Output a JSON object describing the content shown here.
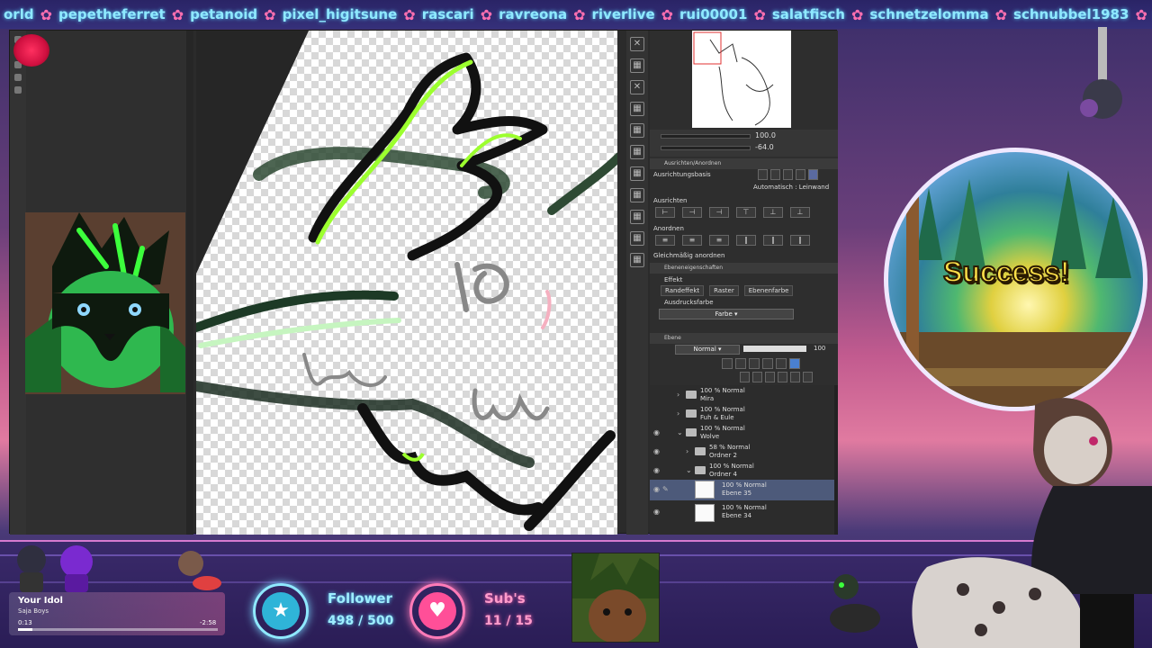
{
  "ticker": {
    "items": [
      "orld",
      "pepetheferret",
      "petanoid",
      "pixel_higitsune",
      "rascari",
      "ravreona",
      "riverlive",
      "rui00001",
      "salatfisch",
      "schnetzelomma",
      "schnubbel1983",
      "schw"
    ]
  },
  "app": {
    "navigator": {
      "zoom": "100.0",
      "rotation": "-64.0"
    },
    "align_panel": {
      "header": "Ausrichten/Anordnen",
      "basis_label": "Ausrichtungsbasis",
      "basis_value": "Automatisch : Leinwand",
      "align_label": "Ausrichten",
      "arrange_label": "Anordnen",
      "distribute_label": "Gleichmäßig anordnen"
    },
    "layer_props": {
      "header": "Ebeneneigenschaften",
      "effect_label": "Effekt",
      "effects": [
        "Randeffekt",
        "Raster",
        "Ebenenfarbe"
      ],
      "expression_label": "Ausdrucksfarbe",
      "expression_value": "Farbe"
    },
    "layers": {
      "header": "Ebene",
      "blend_mode": "Normal",
      "opacity": "100",
      "items": [
        {
          "top": "100 % Normal",
          "name": "Mira",
          "type": "folder",
          "selected": false
        },
        {
          "top": "100 % Normal",
          "name": "Fuh & Eule",
          "type": "folder",
          "selected": false
        },
        {
          "top": "100 % Normal",
          "name": "Wolve",
          "type": "folder",
          "selected": false
        },
        {
          "top": "58 % Normal",
          "name": "Ordner 2",
          "type": "folder",
          "selected": false
        },
        {
          "top": "100 % Normal",
          "name": "Ordner 4",
          "type": "folder",
          "selected": false
        },
        {
          "top": "100 % Normal",
          "name": "Ebene 35",
          "type": "layer",
          "selected": true
        },
        {
          "top": "100 % Normal",
          "name": "Ebene 34",
          "type": "layer",
          "selected": false
        }
      ]
    }
  },
  "overlay": {
    "success": "Success!",
    "music": {
      "title": "Your Idol",
      "artist": "Saja Boys",
      "current": "0:13",
      "remaining": "-2:58",
      "progress": 0.07
    },
    "follower": {
      "label": "Follower",
      "value": "498 / 500"
    },
    "subs": {
      "label": "Sub's",
      "value": "11 / 15"
    }
  },
  "colors": {
    "accent_cyan": "#8fe9ff",
    "accent_pink": "#ff7bb8",
    "lime": "#9cff2e"
  }
}
